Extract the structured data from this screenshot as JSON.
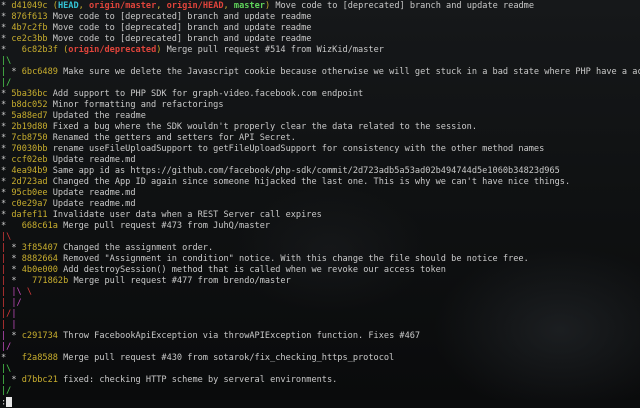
{
  "colors": {
    "hash": "#c8ae2e",
    "text": "#c9c9c9",
    "head": "#33c3d6",
    "remote": "#e0443b",
    "local": "#5fd35a",
    "graph_red": "#d83a3a",
    "graph_green": "#4fd14f",
    "graph_magenta": "#c54dc0",
    "graph_blue": "#4c7fe0",
    "graph_orange": "#e08a2e"
  },
  "lines": [
    [
      {
        "t": "* ",
        "c": "t"
      },
      {
        "t": "d41049c",
        "c": "hash"
      },
      {
        "t": " (",
        "c": "hash"
      },
      {
        "t": "HEAD",
        "c": "head",
        "b": true
      },
      {
        "t": ", ",
        "c": "hash"
      },
      {
        "t": "origin/master",
        "c": "remote",
        "b": true
      },
      {
        "t": ", ",
        "c": "hash"
      },
      {
        "t": "origin/HEAD",
        "c": "remote",
        "b": true
      },
      {
        "t": ", ",
        "c": "hash"
      },
      {
        "t": "master",
        "c": "local",
        "b": true
      },
      {
        "t": ")",
        "c": "hash"
      },
      {
        "t": " Move code to [deprecated] branch and update readme",
        "c": "text"
      }
    ],
    [
      {
        "t": "* ",
        "c": "t"
      },
      {
        "t": "876f613",
        "c": "hash"
      },
      {
        "t": " Move code to [deprecated] branch and update readme",
        "c": "text"
      }
    ],
    [
      {
        "t": "* ",
        "c": "t"
      },
      {
        "t": "4b7c2fb",
        "c": "hash"
      },
      {
        "t": " Move code to [deprecated] branch and update readme",
        "c": "text"
      }
    ],
    [
      {
        "t": "* ",
        "c": "t"
      },
      {
        "t": "ce2c3bb",
        "c": "hash"
      },
      {
        "t": " Move code to [deprecated] branch and update readme",
        "c": "text"
      }
    ],
    [
      {
        "t": "*   ",
        "c": "t"
      },
      {
        "t": "6c82b3f",
        "c": "hash"
      },
      {
        "t": " (",
        "c": "hash"
      },
      {
        "t": "origin/deprecated",
        "c": "remote",
        "b": true
      },
      {
        "t": ")",
        "c": "hash"
      },
      {
        "t": " Merge pull request #514 from WizKid/master",
        "c": "text"
      }
    ],
    [
      {
        "t": "|\\",
        "c": "graph_green"
      }
    ],
    [
      {
        "t": "| ",
        "c": "graph_green"
      },
      {
        "t": "* ",
        "c": "t"
      },
      {
        "t": "6bc6489",
        "c": "hash"
      },
      {
        "t": " Make sure we delete the Javascript cookie because otherwise we will get stuck in a bad state where PHP have a acces",
        "c": "text"
      }
    ],
    [
      {
        "t": "|/",
        "c": "graph_green"
      }
    ],
    [
      {
        "t": "* ",
        "c": "t"
      },
      {
        "t": "5ba36bc",
        "c": "hash"
      },
      {
        "t": " Add support to PHP SDK for graph-video.facebook.com endpoint",
        "c": "text"
      }
    ],
    [
      {
        "t": "* ",
        "c": "t"
      },
      {
        "t": "b8dc052",
        "c": "hash"
      },
      {
        "t": " Minor formatting and refactorings",
        "c": "text"
      }
    ],
    [
      {
        "t": "* ",
        "c": "t"
      },
      {
        "t": "5a88ed7",
        "c": "hash"
      },
      {
        "t": " Updated the readme",
        "c": "text"
      }
    ],
    [
      {
        "t": "* ",
        "c": "t"
      },
      {
        "t": "2b19d80",
        "c": "hash"
      },
      {
        "t": " Fixed a bug where the SDK wouldn't properly clear the data related to the session.",
        "c": "text"
      }
    ],
    [
      {
        "t": "* ",
        "c": "t"
      },
      {
        "t": "7cb8750",
        "c": "hash"
      },
      {
        "t": " Renamed the getters and setters for API Secret.",
        "c": "text"
      }
    ],
    [
      {
        "t": "* ",
        "c": "t"
      },
      {
        "t": "70030bb",
        "c": "hash"
      },
      {
        "t": " rename useFileUploadSupport to getFileUploadSupport for consistency with the other method names",
        "c": "text"
      }
    ],
    [
      {
        "t": "* ",
        "c": "t"
      },
      {
        "t": "ccf02eb",
        "c": "hash"
      },
      {
        "t": " Update readme.md",
        "c": "text"
      }
    ],
    [
      {
        "t": "* ",
        "c": "t"
      },
      {
        "t": "4ea94b9",
        "c": "hash"
      },
      {
        "t": " Same app id as https://github.com/facebook/php-sdk/commit/2d723adb5a53ad02b494744d5e1060b34823d965",
        "c": "text"
      }
    ],
    [
      {
        "t": "* ",
        "c": "t"
      },
      {
        "t": "2d723ad",
        "c": "hash"
      },
      {
        "t": " Changed the App ID again since someone hijacked the last one. This is why we can't have nice things.",
        "c": "text"
      }
    ],
    [
      {
        "t": "* ",
        "c": "t"
      },
      {
        "t": "95cb0ee",
        "c": "hash"
      },
      {
        "t": " Update readme.md",
        "c": "text"
      }
    ],
    [
      {
        "t": "* ",
        "c": "t"
      },
      {
        "t": "c0e29a7",
        "c": "hash"
      },
      {
        "t": " Update readme.md",
        "c": "text"
      }
    ],
    [
      {
        "t": "* ",
        "c": "t"
      },
      {
        "t": "dafef11",
        "c": "hash"
      },
      {
        "t": " Invalidate user data when a REST Server call expires",
        "c": "text"
      }
    ],
    [
      {
        "t": "*   ",
        "c": "t"
      },
      {
        "t": "668c61a",
        "c": "hash"
      },
      {
        "t": " Merge pull request #473 from JuhQ/master",
        "c": "text"
      }
    ],
    [
      {
        "t": "|\\",
        "c": "graph_red"
      }
    ],
    [
      {
        "t": "| ",
        "c": "graph_red"
      },
      {
        "t": "* ",
        "c": "t"
      },
      {
        "t": "3f85407",
        "c": "hash"
      },
      {
        "t": " Changed the assignment order.",
        "c": "text"
      }
    ],
    [
      {
        "t": "| ",
        "c": "graph_red"
      },
      {
        "t": "* ",
        "c": "t"
      },
      {
        "t": "8882664",
        "c": "hash"
      },
      {
        "t": " Removed \"Assignment in condition\" notice. With this change the file should be notice free.",
        "c": "text"
      }
    ],
    [
      {
        "t": "| ",
        "c": "graph_red"
      },
      {
        "t": "* ",
        "c": "t"
      },
      {
        "t": "4b0e000",
        "c": "hash"
      },
      {
        "t": " Add destroySession() method that is called when we revoke our access token",
        "c": "text"
      }
    ],
    [
      {
        "t": "| ",
        "c": "graph_red"
      },
      {
        "t": "*   ",
        "c": "t"
      },
      {
        "t": "771862b",
        "c": "hash"
      },
      {
        "t": " Merge pull request #477 from brendo/master",
        "c": "text"
      }
    ],
    [
      {
        "t": "| ",
        "c": "graph_red"
      },
      {
        "t": "|\\",
        "c": "graph_magenta"
      },
      {
        "t": " \\",
        "c": "graph_red"
      }
    ],
    [
      {
        "t": "| ",
        "c": "graph_red"
      },
      {
        "t": "|/",
        "c": "graph_magenta"
      }
    ],
    [
      {
        "t": "|/",
        "c": "graph_red"
      },
      {
        "t": "|",
        "c": "graph_magenta"
      }
    ],
    [
      {
        "t": "| ",
        "c": "graph_red"
      },
      {
        "t": "|",
        "c": "graph_magenta"
      }
    ],
    [
      {
        "t": "| ",
        "c": "graph_magenta"
      },
      {
        "t": "* ",
        "c": "t"
      },
      {
        "t": "c291734",
        "c": "hash"
      },
      {
        "t": " Throw FacebookApiException via throwAPIException function. Fixes #467",
        "c": "text"
      }
    ],
    [
      {
        "t": "|/",
        "c": "graph_magenta"
      }
    ],
    [
      {
        "t": "*   ",
        "c": "t"
      },
      {
        "t": "f2a8588",
        "c": "hash"
      },
      {
        "t": " Merge pull request #430 from sotarok/fix_checking_https_protocol",
        "c": "text"
      }
    ],
    [
      {
        "t": "|\\",
        "c": "graph_green"
      }
    ],
    [
      {
        "t": "| ",
        "c": "graph_green"
      },
      {
        "t": "* ",
        "c": "t"
      },
      {
        "t": "d7bbc21",
        "c": "hash"
      },
      {
        "t": " fixed: checking HTTP scheme by serveral environments.",
        "c": "text"
      }
    ],
    [
      {
        "t": "|/",
        "c": "graph_green"
      }
    ],
    [
      {
        "t": ":",
        "c": "text"
      },
      {
        "t": "CURSOR",
        "c": "cursor"
      }
    ]
  ]
}
